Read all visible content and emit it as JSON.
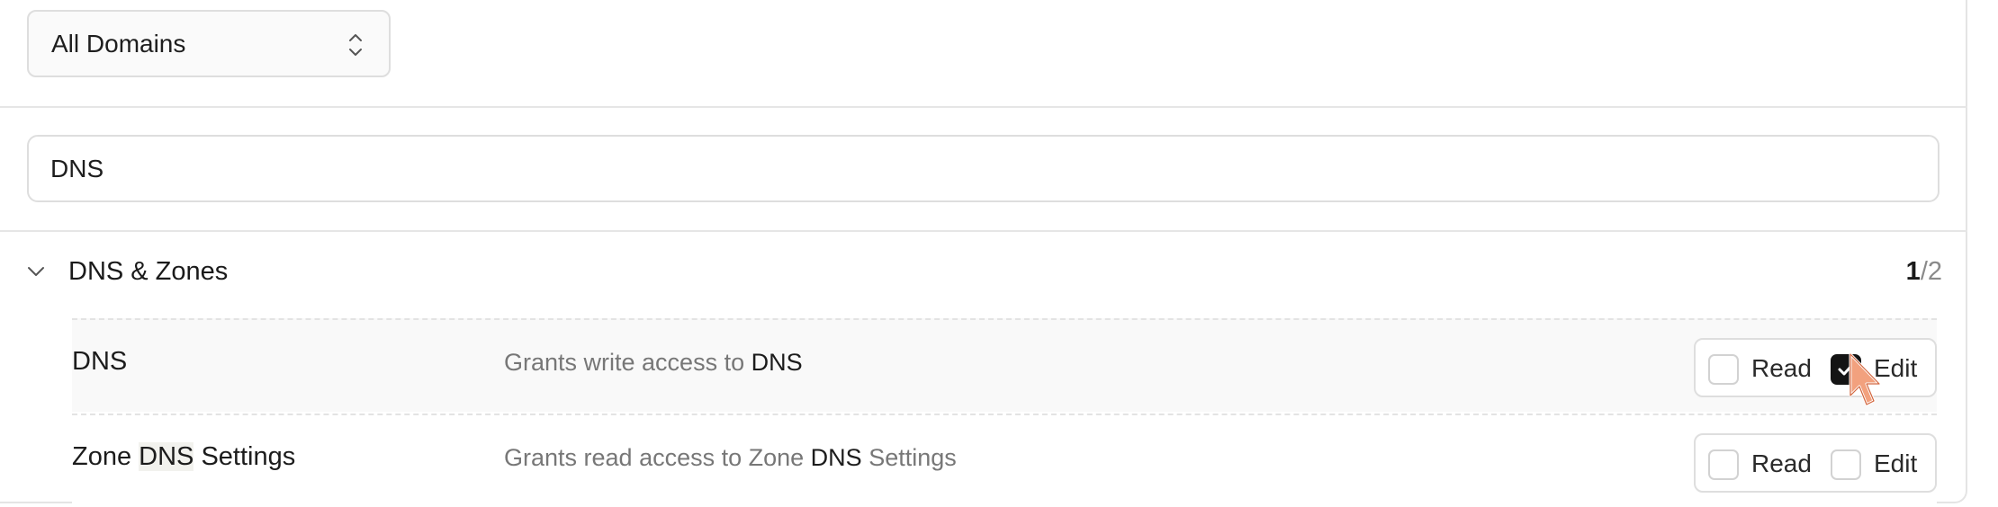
{
  "domain_select": {
    "value": "All Domains",
    "icon": "chevron-up-down-icon"
  },
  "search": {
    "value": "DNS"
  },
  "group": {
    "title": "DNS & Zones",
    "selected_count": "1",
    "total_count": "/2",
    "icon": "chevron-down-icon",
    "expanded": true
  },
  "permissions": [
    {
      "name_parts": [
        "DNS"
      ],
      "desc_parts": [
        "Grants write access to ",
        "DNS"
      ],
      "read_label": "Read",
      "edit_label": "Edit",
      "read_checked": false,
      "edit_checked": true
    },
    {
      "name_parts": [
        "Zone ",
        "DNS",
        " Settings"
      ],
      "desc_parts": [
        "Grants read access to Zone ",
        "DNS",
        " Settings"
      ],
      "read_label": "Read",
      "edit_label": "Edit",
      "read_checked": false,
      "edit_checked": false
    }
  ],
  "colors": {
    "checked_fill": "#141414",
    "highlight_bg": "#f2f2ee",
    "cursor_fill": "#f2a17e"
  }
}
